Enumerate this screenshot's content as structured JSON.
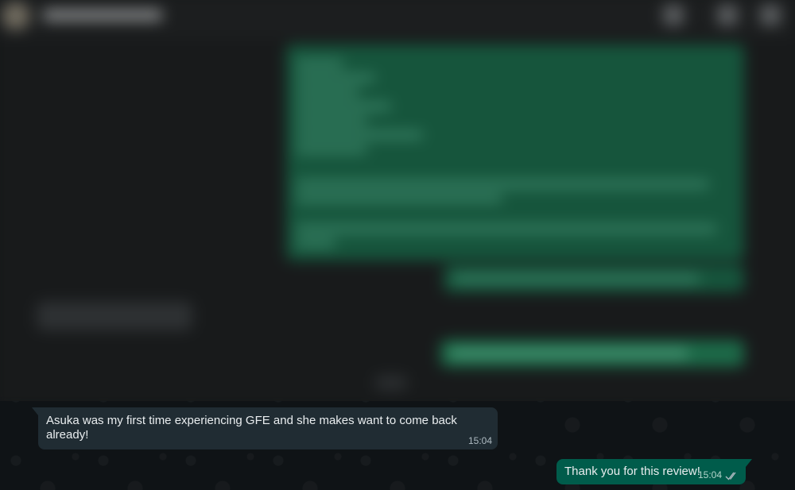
{
  "chat": {
    "messages": [
      {
        "direction": "incoming",
        "text": "Asuka was my first time experiencing GFE and she makes want to come back already!",
        "time": "15:04"
      },
      {
        "direction": "outgoing",
        "text": "Thank you for this review!",
        "time": "15:04",
        "status_icon": "double-check-icon"
      }
    ]
  },
  "colors": {
    "incoming_bubble": "#202c33",
    "outgoing_bubble": "#005c4b",
    "background": "#0b141a"
  }
}
